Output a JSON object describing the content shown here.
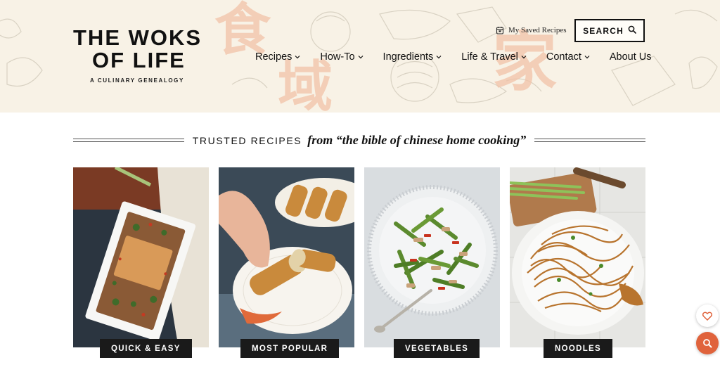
{
  "colors": {
    "header_bg": "#f8f2e6",
    "accent_orange": "#e0633c",
    "label_bg": "#1a1a1a"
  },
  "header": {
    "logo_line1": "THE WOKS",
    "logo_line2": "OF LIFE",
    "logo_tagline": "A CULINARY GENEALOGY",
    "bg_characters": [
      "食",
      "域",
      "家"
    ],
    "saved_recipes": "My Saved Recipes",
    "search_label": "SEARCH",
    "nav": [
      {
        "label": "Recipes",
        "icon": "chevron-down-icon"
      },
      {
        "label": "How-To",
        "icon": "chevron-down-icon"
      },
      {
        "label": "Ingredients",
        "icon": "chevron-down-icon"
      },
      {
        "label": "Life & Travel",
        "icon": "chevron-down-icon"
      },
      {
        "label": "Contact",
        "icon": "chevron-down-icon"
      },
      {
        "label": "About Us",
        "icon": ""
      }
    ]
  },
  "trusted": {
    "caps": "TRUSTED RECIPES",
    "script": "from “the bible of chinese home cooking”"
  },
  "cards": [
    {
      "label": "QUICK & EASY"
    },
    {
      "label": "MOST POPULAR"
    },
    {
      "label": "VEGETABLES"
    },
    {
      "label": "NOODLES"
    }
  ],
  "floating": {
    "favorite_icon": "heart-icon",
    "search_icon": "search-icon"
  }
}
